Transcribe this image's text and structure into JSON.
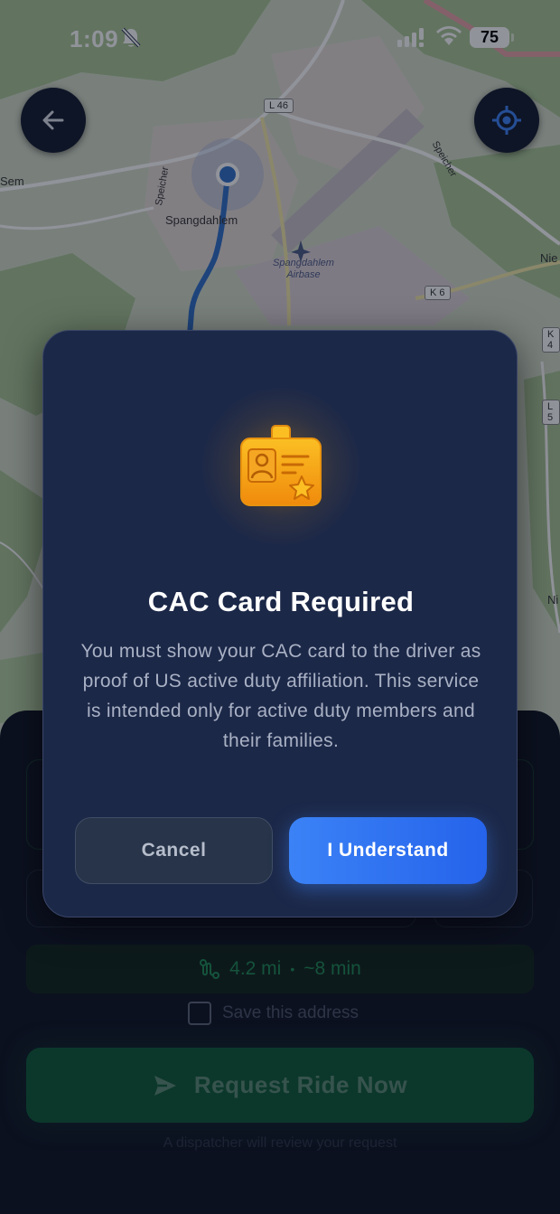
{
  "status_bar": {
    "time": "1:09",
    "battery": "75",
    "icons": [
      "bell-slash-icon",
      "signal-icon",
      "wifi-icon",
      "battery-icon"
    ]
  },
  "map": {
    "labels": {
      "spangdahlem": "Spangdahlem",
      "airbase": "Spangdahlem Airbase",
      "sem": "Sem",
      "nie": "Nie",
      "ni": "Ni",
      "speicher_left": "Speicher",
      "speicher_right": "Speicher"
    },
    "road_badges": {
      "l46": "L 46",
      "k6": "K 6",
      "k4": "K 4",
      "l5": "L 5"
    },
    "colors": {
      "route": "#2f6fc7",
      "location_dot": "#2f6fc7"
    }
  },
  "map_controls": {
    "back_icon": "arrow-left-icon",
    "locate_icon": "crosshair-icon"
  },
  "sheet": {
    "route_distance": "4.2 mi",
    "route_separator": "•",
    "route_time": "~8 min",
    "save_address_label": "Save this address",
    "request_button_label": "Request Ride Now",
    "dispatcher_note": "A dispatcher will review your request",
    "colors": {
      "accent": "#10b981"
    }
  },
  "modal": {
    "icon": "id-card-icon",
    "title": "CAC Card Required",
    "body": "You must show your CAC card to the driver as proof of US active duty affiliation. This service is intended only for active duty members and their families.",
    "cancel_label": "Cancel",
    "confirm_label": "I Understand",
    "colors": {
      "primary": "#3b82f6",
      "icon": "#f59e0b"
    }
  }
}
